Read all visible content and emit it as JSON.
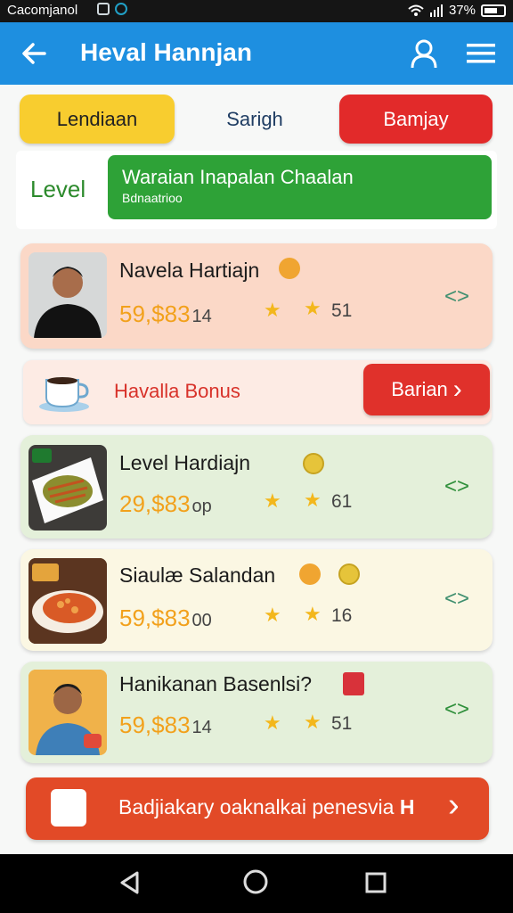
{
  "status_bar": {
    "carrier": "Cacomjanol",
    "battery": "37%"
  },
  "app_bar": {
    "title": "Heval Hannjan",
    "icons": [
      "back-arrow-icon",
      "user-icon",
      "menu-icon"
    ]
  },
  "tabs": [
    {
      "label": "Lendiaan",
      "style": "yellow"
    },
    {
      "label": "Sarigh",
      "style": "plain"
    },
    {
      "label": "Bamjay",
      "style": "red"
    }
  ],
  "level": {
    "label": "Level",
    "banner_title": "Waraian Inapalan Chaalan",
    "banner_sub": "Bdnaatrioo"
  },
  "items": [
    {
      "title": "Navela Hartiajn",
      "price": "59,$83",
      "price_suffix": "14",
      "rating": "51",
      "chevron": "<>"
    },
    {
      "title": "Level Hardiajn",
      "price": "29,$83",
      "price_suffix": "op",
      "rating": "61",
      "chevron": "<>"
    },
    {
      "title": "Siaulæ Salandan",
      "price": "59,$83",
      "price_suffix": "00",
      "rating": "16",
      "chevron": "<>"
    },
    {
      "title": "Hanikanan Basenlsi?",
      "price": "59,$83",
      "price_suffix": "14",
      "rating": "51",
      "chevron": "<>"
    }
  ],
  "bonus": {
    "text": "Havalla Bonus",
    "button": "Barian",
    "button_arrow": "›"
  },
  "cta": {
    "text": "Badjiakary oaknalkai penesvia",
    "trail": "H",
    "arrow": "›"
  },
  "colors": {
    "appbar": "#1e8fe0",
    "accent_red": "#e22a2a",
    "accent_yellow": "#f8cd2f",
    "accent_green": "#2ea237"
  }
}
